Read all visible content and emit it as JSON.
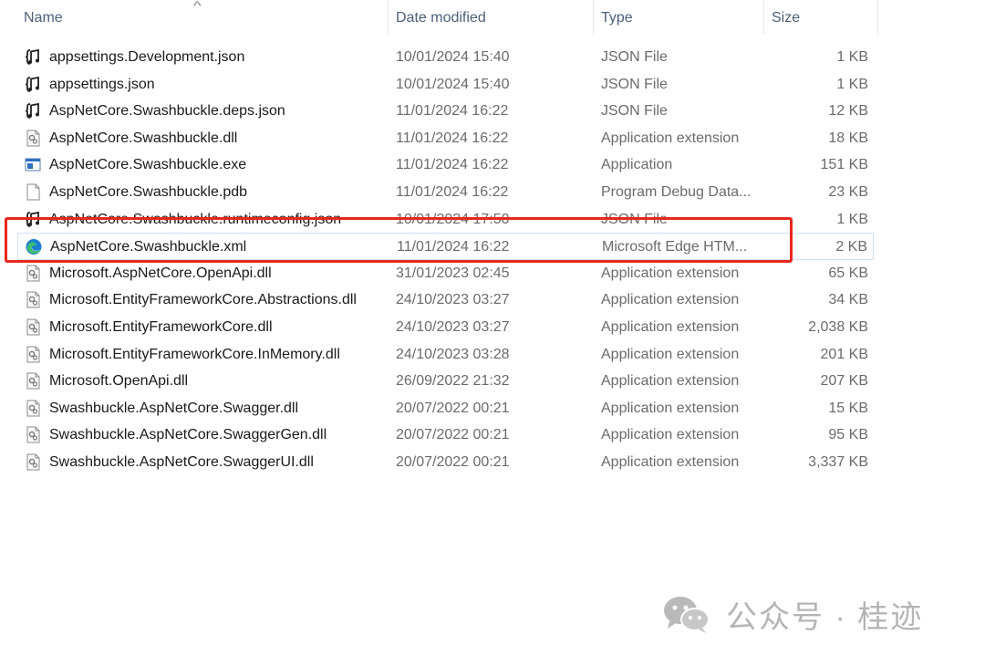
{
  "columns": {
    "name": "Name",
    "date": "Date modified",
    "type": "Type",
    "size": "Size",
    "sort_indicator": "^"
  },
  "files": [
    {
      "name": "appsettings.Development.json",
      "date": "10/01/2024 15:40",
      "type": "JSON File",
      "size": "1 KB",
      "icon": "json-file-icon"
    },
    {
      "name": "appsettings.json",
      "date": "10/01/2024 15:40",
      "type": "JSON File",
      "size": "1 KB",
      "icon": "json-file-icon"
    },
    {
      "name": "AspNetCore.Swashbuckle.deps.json",
      "date": "11/01/2024 16:22",
      "type": "JSON File",
      "size": "12 KB",
      "icon": "json-file-icon"
    },
    {
      "name": "AspNetCore.Swashbuckle.dll",
      "date": "11/01/2024 16:22",
      "type": "Application extension",
      "size": "18 KB",
      "icon": "dll-file-icon"
    },
    {
      "name": "AspNetCore.Swashbuckle.exe",
      "date": "11/01/2024 16:22",
      "type": "Application",
      "size": "151 KB",
      "icon": "exe-file-icon"
    },
    {
      "name": "AspNetCore.Swashbuckle.pdb",
      "date": "11/01/2024 16:22",
      "type": "Program Debug Data...",
      "size": "23 KB",
      "icon": "blank-file-icon"
    },
    {
      "name": "AspNetCore.Swashbuckle.runtimeconfig.json",
      "date": "10/01/2024 17:50",
      "type": "JSON File",
      "size": "1 KB",
      "icon": "json-file-icon"
    },
    {
      "name": "AspNetCore.Swashbuckle.xml",
      "date": "11/01/2024 16:22",
      "type": "Microsoft Edge HTM...",
      "size": "2 KB",
      "icon": "edge-icon",
      "selected": true
    },
    {
      "name": "Microsoft.AspNetCore.OpenApi.dll",
      "date": "31/01/2023 02:45",
      "type": "Application extension",
      "size": "65 KB",
      "icon": "dll-file-icon"
    },
    {
      "name": "Microsoft.EntityFrameworkCore.Abstractions.dll",
      "date": "24/10/2023 03:27",
      "type": "Application extension",
      "size": "34 KB",
      "icon": "dll-file-icon"
    },
    {
      "name": "Microsoft.EntityFrameworkCore.dll",
      "date": "24/10/2023 03:27",
      "type": "Application extension",
      "size": "2,038 KB",
      "icon": "dll-file-icon"
    },
    {
      "name": "Microsoft.EntityFrameworkCore.InMemory.dll",
      "date": "24/10/2023 03:28",
      "type": "Application extension",
      "size": "201 KB",
      "icon": "dll-file-icon"
    },
    {
      "name": "Microsoft.OpenApi.dll",
      "date": "26/09/2022 21:32",
      "type": "Application extension",
      "size": "207 KB",
      "icon": "dll-file-icon"
    },
    {
      "name": "Swashbuckle.AspNetCore.Swagger.dll",
      "date": "20/07/2022 00:21",
      "type": "Application extension",
      "size": "15 KB",
      "icon": "dll-file-icon"
    },
    {
      "name": "Swashbuckle.AspNetCore.SwaggerGen.dll",
      "date": "20/07/2022 00:21",
      "type": "Application extension",
      "size": "95 KB",
      "icon": "dll-file-icon"
    },
    {
      "name": "Swashbuckle.AspNetCore.SwaggerUI.dll",
      "date": "20/07/2022 00:21",
      "type": "Application extension",
      "size": "3,337 KB",
      "icon": "dll-file-icon"
    }
  ],
  "watermark": {
    "text": "公众号 · 桂迹",
    "icon": "wechat-icon"
  },
  "colors": {
    "highlight_box": "#e8271c",
    "header_text": "#4c6079",
    "selection_border": "#cfe3f5",
    "edge_blue": "#1b7fd6",
    "edge_green": "#3cc06f"
  }
}
